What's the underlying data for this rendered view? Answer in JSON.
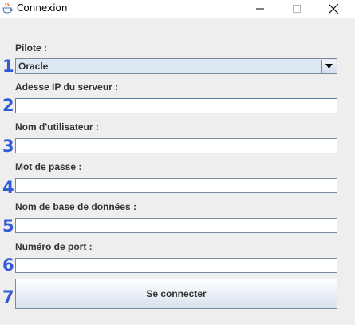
{
  "window": {
    "title": "Connexion",
    "app_icon": "java-cup-icon",
    "minimize_icon": "minimize-icon",
    "maximize_icon": "maximize-icon",
    "close_icon": "close-icon"
  },
  "form": {
    "pilot": {
      "number": "1",
      "label": "Pilote :",
      "selected": "Oracle"
    },
    "server_ip": {
      "number": "2",
      "label": "Adesse IP du serveur :",
      "value": ""
    },
    "username": {
      "number": "3",
      "label": "Nom d'utilisateur :",
      "value": ""
    },
    "password": {
      "number": "4",
      "label": "Mot de passe :",
      "value": ""
    },
    "database_name": {
      "number": "5",
      "label": "Nom de base de données :",
      "value": ""
    },
    "port": {
      "number": "6",
      "label": "Numéro de port :",
      "value": ""
    },
    "connect": {
      "number": "7",
      "label": "Se connecter"
    }
  },
  "colors": {
    "step_number": "#2f5bd7",
    "field_border": "#7a8a99",
    "combo_background": "#dde8f3",
    "panel_background": "#eeeeee"
  }
}
